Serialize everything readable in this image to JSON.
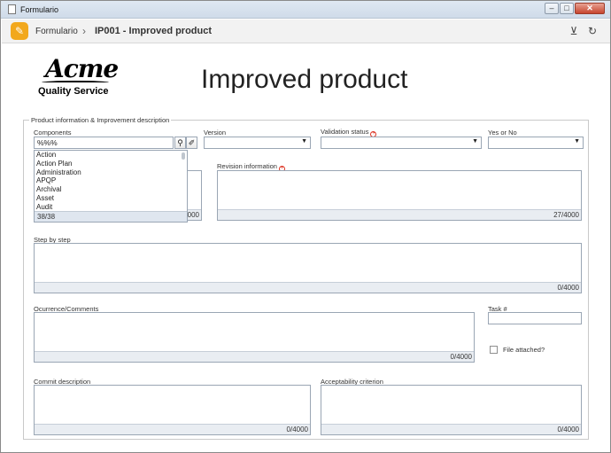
{
  "window": {
    "title": "Formulario"
  },
  "header": {
    "breadcrumb_root": "Formulario",
    "breadcrumb_separator": "›",
    "breadcrumb_current": "IP001 - Improved product"
  },
  "logo": {
    "brand": "Acme",
    "subtitle": "Quality Service"
  },
  "page": {
    "title": "Improved product"
  },
  "section": {
    "legend": "Product information & Improvement description"
  },
  "components": {
    "label": "Components",
    "value": "%%%",
    "dropdown_items": [
      "Action",
      "Action Plan",
      "Administration",
      "APQP",
      "Archival",
      "Asset",
      "Audit"
    ],
    "dropdown_count": "38/38"
  },
  "version": {
    "label": "Version",
    "value": ""
  },
  "validation_status": {
    "label": "Validation status",
    "value": ""
  },
  "yes_or_no": {
    "label": "Yes or No",
    "value": ""
  },
  "hidden_field": {
    "counter_suffix": "4000"
  },
  "revision_information": {
    "label": "Revision information",
    "counter": "27/4000"
  },
  "step_by_step": {
    "label": "Step by step",
    "counter": "0/4000"
  },
  "occurrence_comments": {
    "label": "Ocurrence/Comments",
    "counter": "0/4000"
  },
  "task": {
    "label": "Task #",
    "value": ""
  },
  "file_attached": {
    "label": "File attached?",
    "checked": false
  },
  "commit_description": {
    "label": "Commit description",
    "counter": "0/4000"
  },
  "acceptability_criterion": {
    "label": "Acceptability criterion",
    "counter": "0/4000"
  }
}
